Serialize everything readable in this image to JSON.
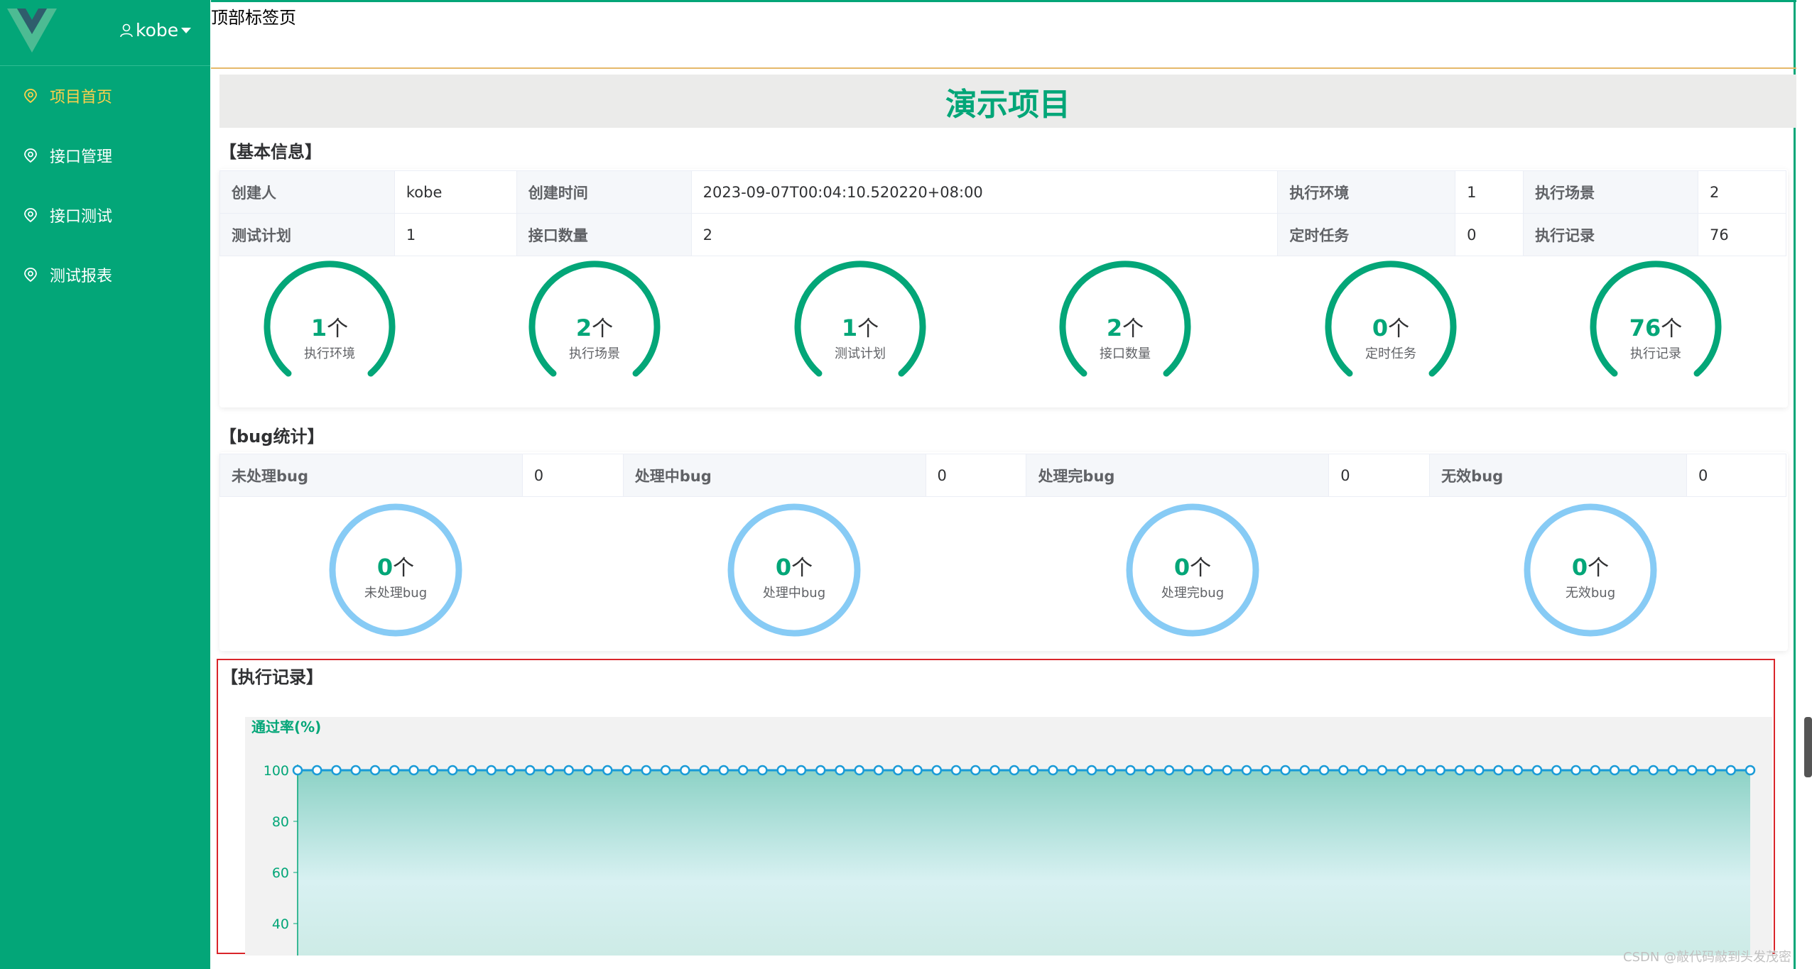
{
  "sidebar": {
    "user": "kobe",
    "items": [
      {
        "label": "项目首页",
        "active": true
      },
      {
        "label": "接口管理",
        "active": false
      },
      {
        "label": "接口测试",
        "active": false
      },
      {
        "label": "测试报表",
        "active": false
      }
    ]
  },
  "topbar": {
    "label": "顶部标签页"
  },
  "project": {
    "title": "演示项目"
  },
  "basic": {
    "title": "【基本信息】",
    "creator_label": "创建人",
    "creator": "kobe",
    "created_label": "创建时间",
    "created": "2023-09-07T00:04:10.520220+08:00",
    "env_label": "执行环境",
    "env": "1",
    "scene_label": "执行场景",
    "scene": "2",
    "plan_label": "测试计划",
    "plan": "1",
    "api_label": "接口数量",
    "api": "2",
    "task_label": "定时任务",
    "task": "0",
    "record_label": "执行记录",
    "record": "76"
  },
  "gauges": [
    {
      "num": "1",
      "unit": "个",
      "label": "执行环境"
    },
    {
      "num": "2",
      "unit": "个",
      "label": "执行场景"
    },
    {
      "num": "1",
      "unit": "个",
      "label": "测试计划"
    },
    {
      "num": "2",
      "unit": "个",
      "label": "接口数量"
    },
    {
      "num": "0",
      "unit": "个",
      "label": "定时任务"
    },
    {
      "num": "76",
      "unit": "个",
      "label": "执行记录"
    }
  ],
  "bug": {
    "title": "【bug统计】",
    "untreated_label": "未处理bug",
    "untreated": "0",
    "processing_label": "处理中bug",
    "processing": "0",
    "done_label": "处理完bug",
    "done": "0",
    "invalid_label": "无效bug",
    "invalid": "0"
  },
  "bug_circles": [
    {
      "num": "0",
      "unit": "个",
      "label": "未处理bug"
    },
    {
      "num": "0",
      "unit": "个",
      "label": "处理中bug"
    },
    {
      "num": "0",
      "unit": "个",
      "label": "处理完bug"
    },
    {
      "num": "0",
      "unit": "个",
      "label": "无效bug"
    }
  ],
  "records": {
    "title": "【执行记录】"
  },
  "colors": {
    "primary": "#03a678",
    "active_menu": "#ffd04b",
    "bug_ring": "#87cbf5",
    "line": "#1a9bd7"
  },
  "chart_data": {
    "type": "area",
    "ylabel": "通过率(%)",
    "yticks": [
      "100",
      "80",
      "60",
      "40"
    ],
    "ylim": [
      40,
      100
    ],
    "series": [
      {
        "values": [
          100,
          100,
          100,
          100,
          100,
          100,
          100,
          100,
          100,
          100,
          100,
          100,
          100,
          100,
          100,
          100,
          100,
          100,
          100,
          100,
          100,
          100,
          100,
          100,
          100,
          100,
          100,
          100,
          100,
          100,
          100,
          100,
          100,
          100,
          100,
          100,
          100,
          100,
          100,
          100,
          100,
          100,
          100,
          100,
          100,
          100,
          100,
          100,
          100,
          100,
          100,
          100,
          100,
          100,
          100,
          100,
          100,
          100,
          100,
          100,
          100,
          100,
          100,
          100,
          100,
          100,
          100,
          100,
          100,
          100,
          100,
          100,
          100,
          100,
          100,
          100
        ]
      }
    ]
  },
  "watermark": "CSDN @敲代码敲到头发茂密"
}
